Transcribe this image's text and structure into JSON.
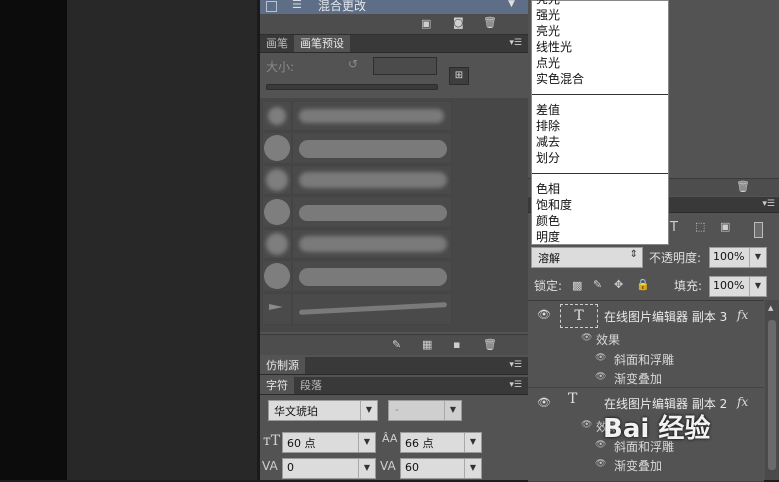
{
  "layers_top": {
    "item_label": "混合更改"
  },
  "brush_panel": {
    "tabs": [
      "画笔",
      "画笔预设"
    ],
    "size_label": "大小:"
  },
  "clone_panel": {
    "tab": "仿制源"
  },
  "char_panel": {
    "tabs": [
      "字符",
      "段落"
    ],
    "font_family": "华文琥珀",
    "font_style": "-",
    "font_size": "60 点",
    "leading": "66 点",
    "kerning": "0",
    "tracking": "60"
  },
  "blend_dropdown": {
    "group1": [
      "亮光",
      "强光",
      "亮光",
      "线性光",
      "点光",
      "实色混合"
    ],
    "group2": [
      "差值",
      "排除",
      "减去",
      "划分"
    ],
    "group3": [
      "色相",
      "饱和度",
      "颜色",
      "明度"
    ]
  },
  "layers_panel": {
    "blend_mode": "溶解",
    "opacity_label": "不透明度:",
    "opacity_value": "100%",
    "lock_label": "锁定:",
    "fill_label": "填充:",
    "fill_value": "100%",
    "layers": [
      {
        "name": "在线图片编辑器 副本 3",
        "effects_label": "效果",
        "effects": [
          "斜面和浮雕",
          "渐变叠加"
        ]
      },
      {
        "name": "在线图片编辑器 副本 2",
        "effects_label": "效果",
        "effects": [
          "斜面和浮雕",
          "渐变叠加"
        ]
      }
    ]
  },
  "watermark": "Bai 经验",
  "colors": {
    "panel": "#535353",
    "tabbar": "#393939",
    "accent_selected": "#5d6e86"
  }
}
